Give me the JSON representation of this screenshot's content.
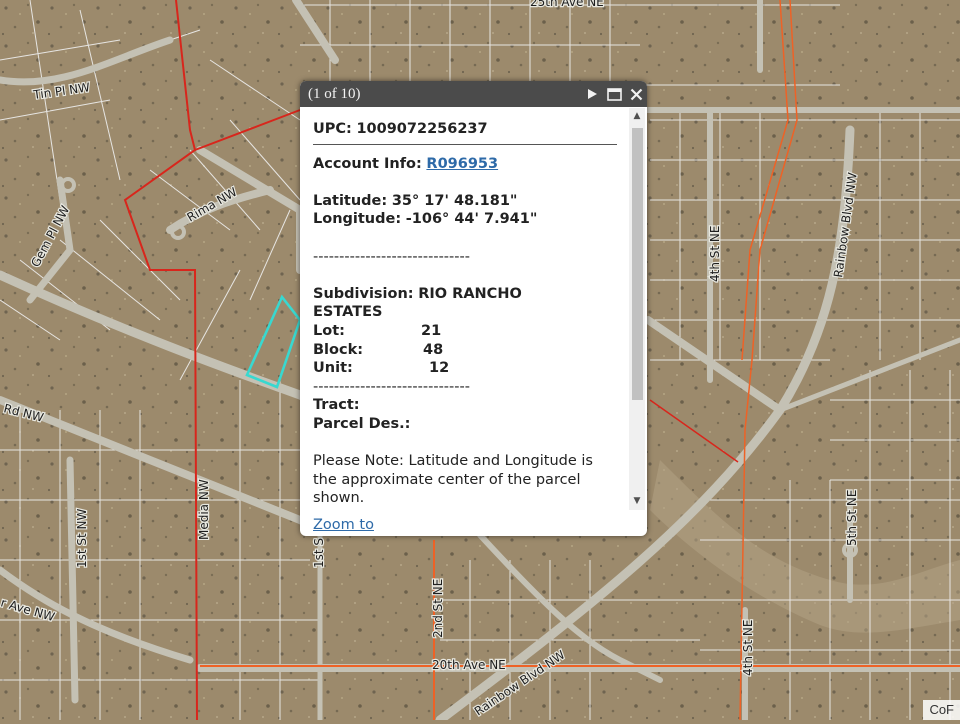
{
  "map": {
    "road_labels": {
      "ave25": "25th Ave NE",
      "tin_pl": "Tin Pl NW",
      "gem_pl": "Gem Pl NW",
      "rima": "Rima NW",
      "rd_nw": "Rd NW",
      "media": "Media NW",
      "st1": "1st St NW",
      "st1b": "1st S",
      "ave_nw": "r Ave NW",
      "st2": "2nd St NE",
      "ave20": "20th Ave NE",
      "rainbow_sw": "Rainbow Blvd NW",
      "rainbow_ne": "Rainbow Blvd NW",
      "st4_top": "4th St NE",
      "st4_bot": "4th St NE",
      "st5": "5th St NE"
    },
    "attribution": "CoF",
    "colors": {
      "ground": "#9c8a6c",
      "road": "#c2bfb2",
      "parcel_line": "#f2f2f2",
      "boundary_red": "#d8261c",
      "boundary_orange": "#ee6226",
      "selected_parcel": "#38d8d0"
    }
  },
  "popup": {
    "counter": "(1 of 10)",
    "icons": {
      "next": "play-icon",
      "maximize": "maximize-icon",
      "close": "close-icon"
    },
    "upc_label": "UPC:",
    "upc_value": "1009072256237",
    "account_label": "Account Info:",
    "account_value": "R096953",
    "latitude_label": "Latitude:",
    "latitude_value": "35° 17' 48.181\"",
    "longitude_label": "Longitude:",
    "longitude_value": "-106° 44' 7.941\"",
    "separator": "------------------------------",
    "subdivision_label": "Subdivision:",
    "subdivision_value": "RIO RANCHO",
    "subdivision_value2": "ESTATES",
    "lot_label": "Lot:",
    "lot_value": "21",
    "block_label": "Block:",
    "block_value": "48",
    "unit_label": "Unit:",
    "unit_value": "12",
    "tract_label": "Tract:",
    "parcel_des_label": "Parcel Des.:",
    "note_line1": "Please Note: Latitude and Longitude is",
    "note_line2": "the approximate center of the parcel",
    "note_line3": "shown.",
    "zoom_label": "Zoom to"
  }
}
